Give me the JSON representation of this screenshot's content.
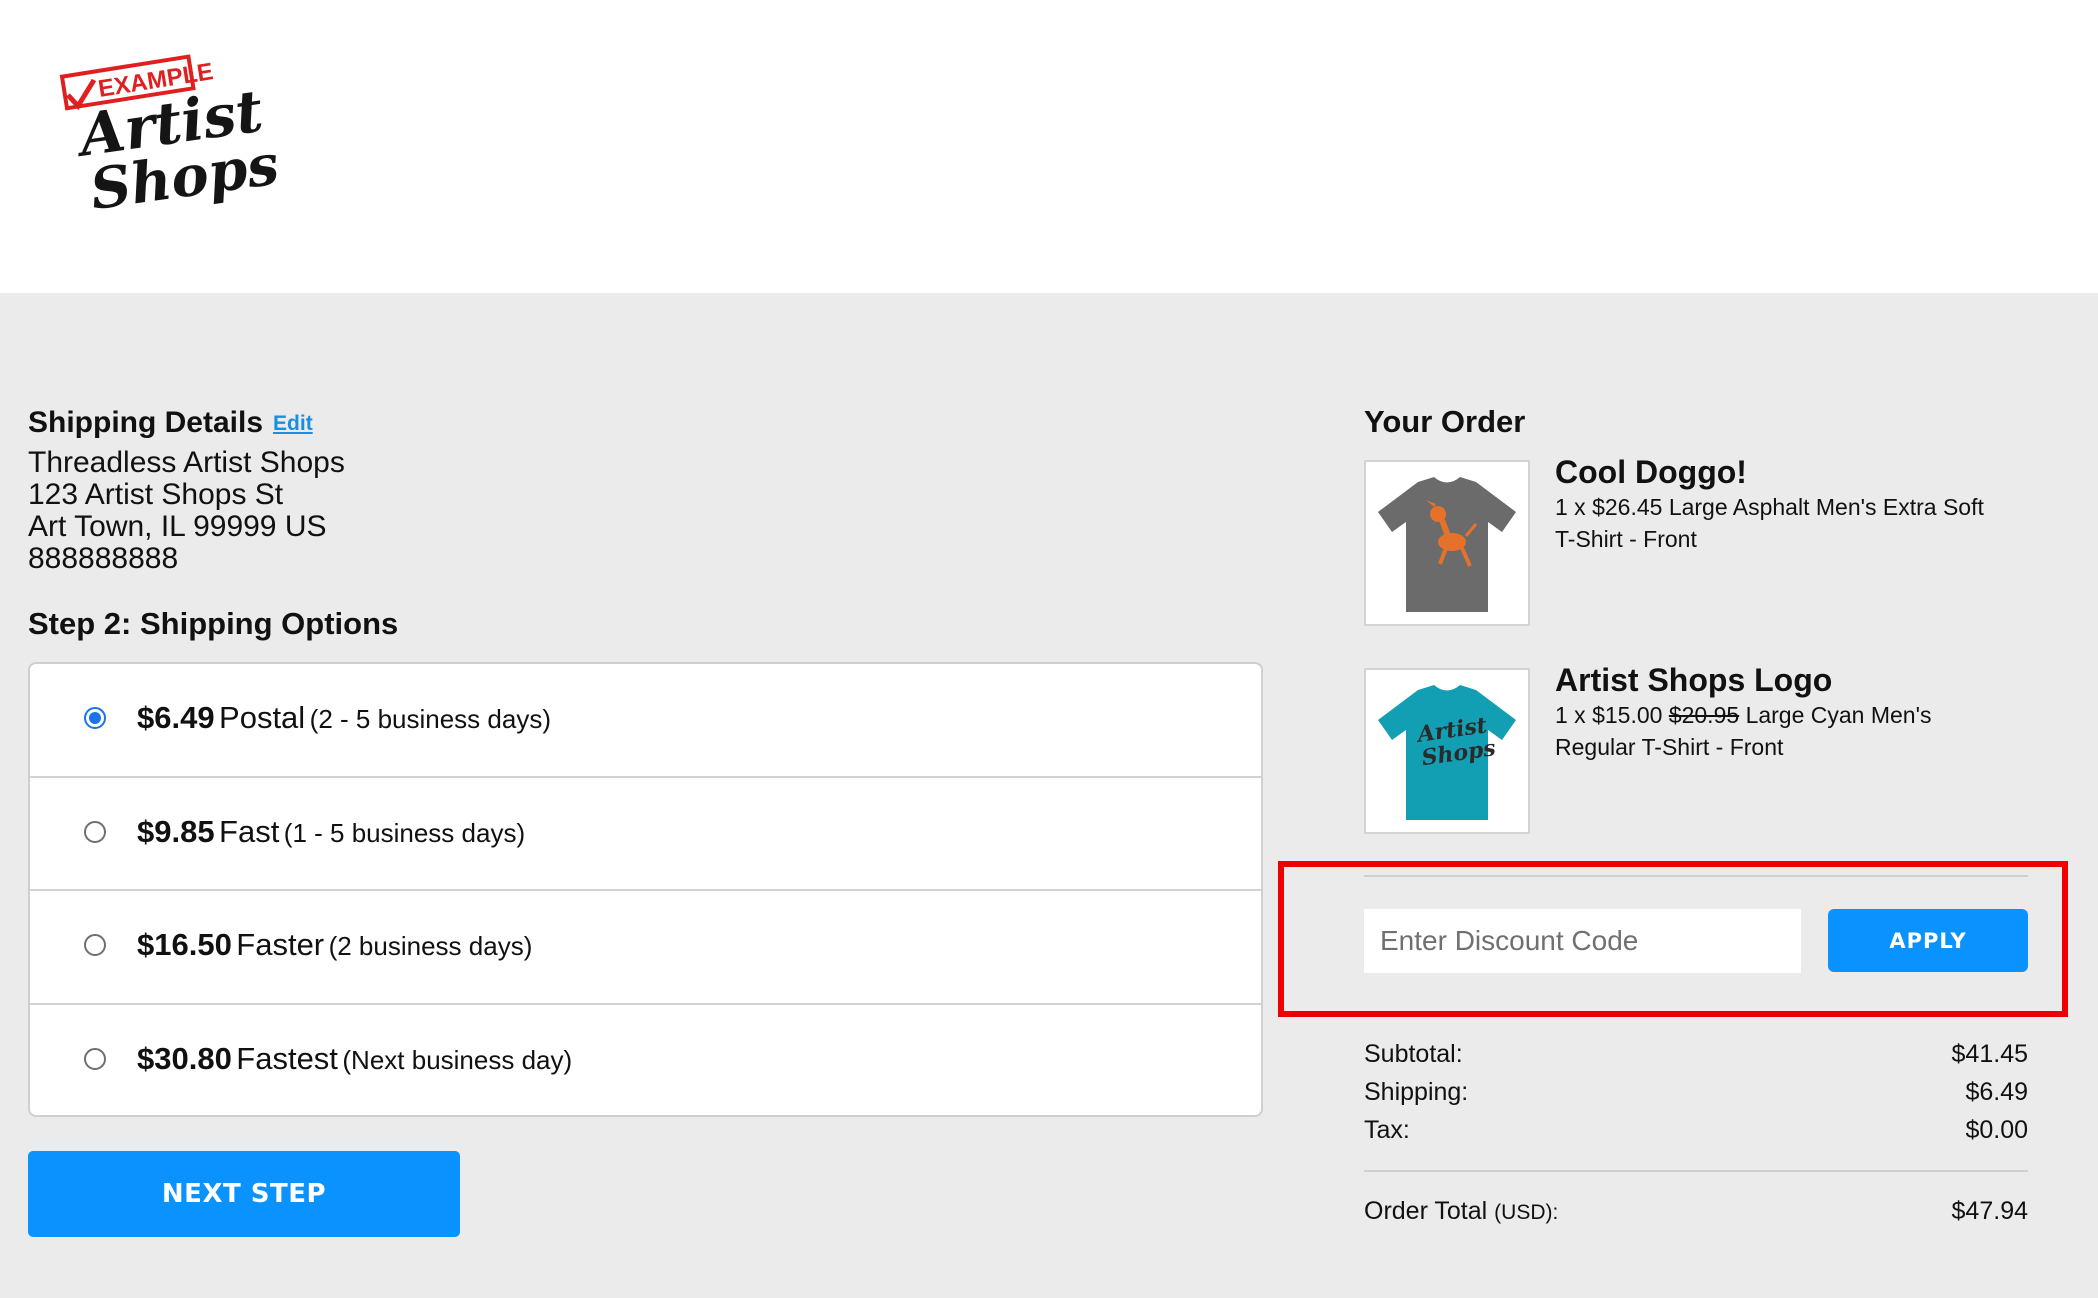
{
  "logo": {
    "stamp_text": "EXAMPLE",
    "brand_text": "Artist Shops"
  },
  "shipping_details": {
    "title": "Shipping Details",
    "edit_label": "Edit",
    "name": "Threadless Artist Shops",
    "street": "123 Artist Shops St",
    "city_line": "Art Town, IL 99999 US",
    "phone": "888888888"
  },
  "shipping_options": {
    "title": "Step 2: Shipping Options",
    "options": [
      {
        "price": "$6.49",
        "name": "Postal",
        "days": "(2 - 5 business days)",
        "selected": true
      },
      {
        "price": "$9.85",
        "name": "Fast",
        "days": "(1 - 5 business days)",
        "selected": false
      },
      {
        "price": "$16.50",
        "name": "Faster",
        "days": "(2 business days)",
        "selected": false
      },
      {
        "price": "$30.80",
        "name": "Fastest",
        "days": "(Next business day)",
        "selected": false
      }
    ]
  },
  "next_step_label": "NEXT STEP",
  "order": {
    "title": "Your Order",
    "items": [
      {
        "title": "Cool Doggo!",
        "qty_price": "1 x $26.45",
        "original_price": "",
        "desc_rest": "Large Asphalt Men's Extra Soft",
        "desc_line2": "T-Shirt - Front",
        "shirt_color": "#6b6b6b",
        "graphic": "orange-dog"
      },
      {
        "title": "Artist Shops Logo",
        "qty_price": "1 x $15.00",
        "original_price": "$20.95",
        "desc_rest": "Large Cyan Men's",
        "desc_line2": "Regular T-Shirt - Front",
        "shirt_color": "#139fb3",
        "graphic": "artist-shops-script"
      }
    ]
  },
  "discount": {
    "placeholder": "Enter Discount Code",
    "value": "",
    "apply_label": "APPLY"
  },
  "summary": {
    "subtotal_label": "Subtotal:",
    "subtotal_value": "$41.45",
    "shipping_label": "Shipping:",
    "shipping_value": "$6.49",
    "tax_label": "Tax:",
    "tax_value": "$0.00",
    "total_label": "Order Total",
    "total_currency": "(USD):",
    "total_value": "$47.94"
  },
  "colors": {
    "accent_blue": "#0a93ff",
    "highlight_red": "#ee0000",
    "page_bg": "#ebebeb"
  }
}
